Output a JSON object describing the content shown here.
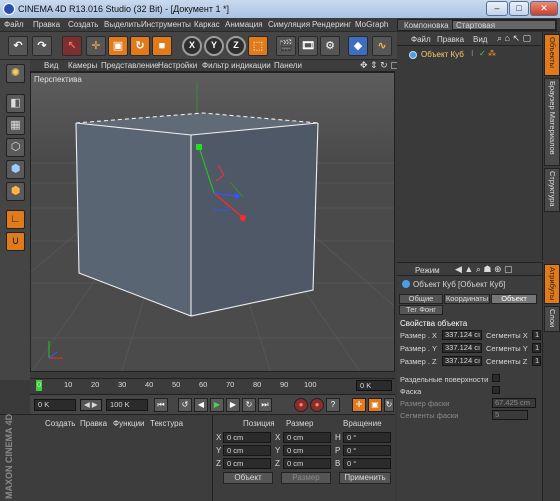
{
  "window": {
    "title": "CINEMA 4D R13.016 Studio (32 Bit) - [Документ 1 *]",
    "minimize": "–",
    "maximize": "□",
    "close": "✕"
  },
  "menubar": {
    "items": [
      "Файл",
      "Правка",
      "Создать",
      "Выделить",
      "Инструменты",
      "Каркас",
      "Анимация",
      "Симуляция",
      "Рендеринг",
      "MoGraph"
    ],
    "layout_label": "Компоновка",
    "layout_value": "Стартовая"
  },
  "toolbar": {
    "icons": [
      "undo-icon",
      "redo-icon",
      "live-selection-icon",
      "move-icon",
      "scale-icon",
      "rotate-icon",
      "recent-tool-icon",
      "x-axis-icon",
      "y-axis-icon",
      "z-axis-icon",
      "coordinate-system-icon",
      "render-view-icon",
      "render-picture-viewer-icon",
      "render-settings-icon",
      "cube-object-icon",
      "spline-pen-icon"
    ],
    "axis_labels": [
      "X",
      "Y",
      "Z"
    ]
  },
  "left_toolbar": {
    "icons": [
      "make-editable-icon",
      "model-mode-icon",
      "texture-mode-icon",
      "points-mode-icon",
      "edges-mode-icon",
      "polygons-mode-icon",
      "axis-mode-icon",
      "snap-icon"
    ]
  },
  "viewport": {
    "menu": [
      "Вид",
      "Камеры",
      "Представление",
      "Настройки",
      "Фильтр индикации",
      "Панели"
    ],
    "label": "Перспектива"
  },
  "timeline": {
    "ticks": [
      "0",
      "10",
      "20",
      "30",
      "40",
      "50",
      "60",
      "70",
      "80",
      "90",
      "100"
    ],
    "end_field": "0 K"
  },
  "transport": {
    "start": "0 K",
    "step": "◀ ▶",
    "end": "100 K"
  },
  "material_manager": {
    "menu": [
      "Создать",
      "Правка",
      "Функции",
      "Текстура"
    ],
    "logo": "MAXON CINEMA 4D"
  },
  "coordinates": {
    "headers": [
      "Позиция",
      "Размер",
      "Вращение"
    ],
    "rows": [
      {
        "axis": "X",
        "pos": "0 cm",
        "size_axis": "X",
        "size": "0 cm",
        "rot_axis": "H",
        "rot": "0 °"
      },
      {
        "axis": "Y",
        "pos": "0 cm",
        "size_axis": "Y",
        "size": "0 cm",
        "rot_axis": "P",
        "rot": "0 °"
      },
      {
        "axis": "Z",
        "pos": "0 cm",
        "size_axis": "Z",
        "size": "0 cm",
        "rot_axis": "B",
        "rot": "0 °"
      }
    ],
    "mode": "Объект",
    "size_mode": "Размер",
    "apply": "Применить"
  },
  "object_manager": {
    "menu": [
      "Файл",
      "Правка",
      "Вид"
    ],
    "objects": [
      {
        "name": "Объект Куб"
      }
    ]
  },
  "right_tabs_top": [
    "Объекты",
    "Браузер Материалов",
    "Структура"
  ],
  "right_tabs_bottom": [
    "Атрибуты",
    "Слои"
  ],
  "attributes": {
    "mode_label": "Режим",
    "title": "Объект Куб [Объект Куб]",
    "tabs": [
      "Общие",
      "Координаты",
      "Объект"
    ],
    "tab_phong": "Тег Фонг",
    "section": "Свойства объекта",
    "size_rows": [
      {
        "label": "Размер . X",
        "value": "337.124 cı",
        "seg_label": "Сегменты X",
        "seg": "1"
      },
      {
        "label": "Размер . Y",
        "value": "337.124 cı",
        "seg_label": "Сегменты Y",
        "seg": "1"
      },
      {
        "label": "Размер . Z",
        "value": "337.124 cı",
        "seg_label": "Сегменты Z",
        "seg": "1"
      }
    ],
    "separate_surfaces": "Раздельные поверхности",
    "fillet": "Фаска",
    "fillet_radius_label": "Размер фаски",
    "fillet_radius_value": "67.425 cm",
    "fillet_segments_label": "Сегменты фаски",
    "fillet_segments_value": "5"
  },
  "colors": {
    "accent": "#e07a1b",
    "background": "#3a3a3a",
    "object_name": "#ffcc66"
  }
}
